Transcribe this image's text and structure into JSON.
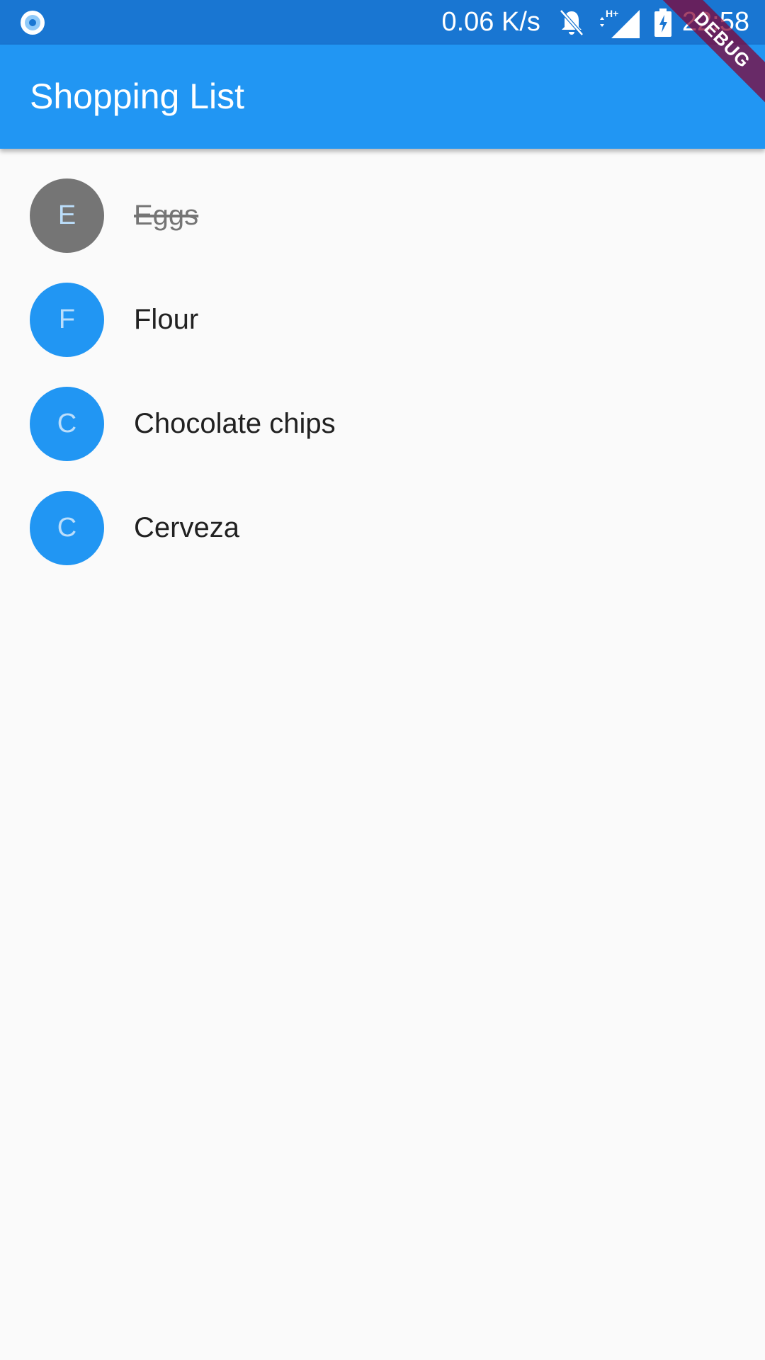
{
  "status_bar": {
    "net_speed": "0.06 K/s",
    "time": "22:58",
    "icons": [
      "record-icon",
      "bell-off-icon",
      "signal-icon",
      "battery-charging-icon"
    ],
    "background": "#1976d2"
  },
  "app_bar": {
    "title": "Shopping List",
    "background": "#2196f3"
  },
  "debug_banner": "DEBUG",
  "items": [
    {
      "initial": "E",
      "name": "Eggs",
      "checked": true,
      "avatar_color": "#757575"
    },
    {
      "initial": "F",
      "name": "Flour",
      "checked": false,
      "avatar_color": "#2196f3"
    },
    {
      "initial": "C",
      "name": "Chocolate chips",
      "checked": false,
      "avatar_color": "#2196f3"
    },
    {
      "initial": "C",
      "name": "Cerveza",
      "checked": false,
      "avatar_color": "#2196f3"
    }
  ]
}
